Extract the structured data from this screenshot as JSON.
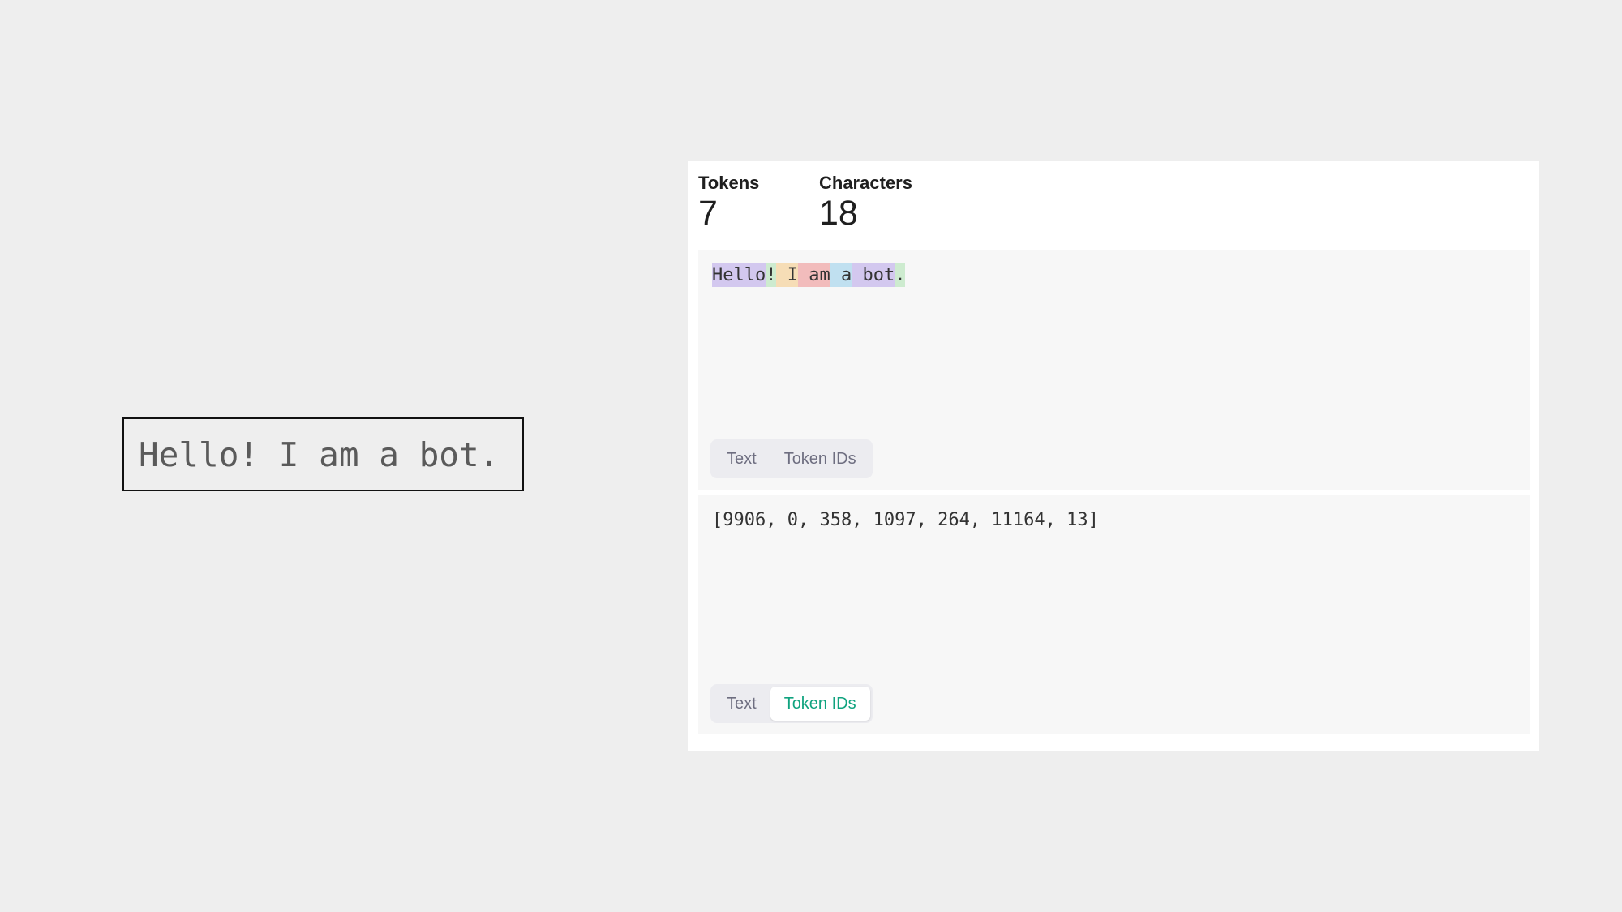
{
  "input": {
    "text": "Hello! I am a bot."
  },
  "stats": {
    "tokens_label": "Tokens",
    "tokens_value": "7",
    "characters_label": "Characters",
    "characters_value": "18"
  },
  "tokens": [
    {
      "text": "Hello",
      "color": "#d3c8ef"
    },
    {
      "text": "!",
      "color": "#cdebcf"
    },
    {
      "text": " I",
      "color": "#f6ddb6"
    },
    {
      "text": " am",
      "color": "#f2bcbc"
    },
    {
      "text": " a",
      "color": "#c0e0f0"
    },
    {
      "text": " bot",
      "color": "#d3c8ef"
    },
    {
      "text": ".",
      "color": "#cdebcf"
    }
  ],
  "token_ids_text": "[9906, 0, 358, 1097, 264, 11164, 13]",
  "view_tabs": {
    "text_label": "Text",
    "ids_label": "Token IDs"
  },
  "colors": {
    "active_tab": "#10a37f",
    "background": "#eeeeee",
    "panel": "#ffffff",
    "block": "#f7f7f7"
  }
}
